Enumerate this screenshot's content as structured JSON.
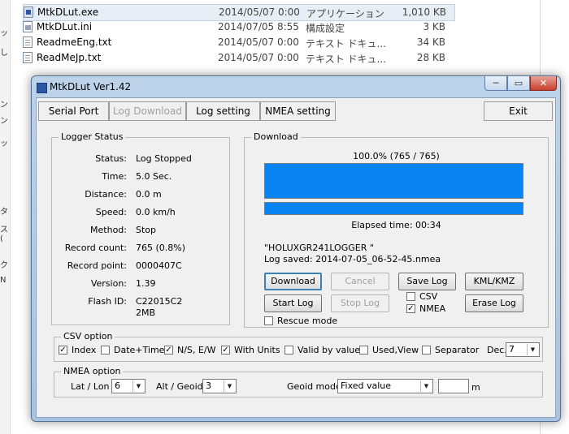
{
  "explorer": {
    "files": [
      {
        "name": "MtkDLut.exe",
        "date": "2014/05/07 0:00",
        "type": "アプリケーション",
        "size": "1,010 KB",
        "icon": "exe-icon"
      },
      {
        "name": "MtkDLut.ini",
        "date": "2014/07/05 8:55",
        "type": "構成設定",
        "size": "3 KB",
        "icon": "ini-icon"
      },
      {
        "name": "ReadmeEng.txt",
        "date": "2014/05/07 0:00",
        "type": "テキスト ドキュ...",
        "size": "34 KB",
        "icon": "text-file-icon"
      },
      {
        "name": "ReadMeJp.txt",
        "date": "2014/05/07 0:00",
        "type": "テキスト ドキュ...",
        "size": "28 KB",
        "icon": "text-file-icon"
      }
    ],
    "left_strip_chars": [
      "ン",
      "ッ",
      "し",
      "ン",
      "ッ",
      "タ",
      "ス (",
      "ク",
      "N"
    ]
  },
  "window": {
    "title": "MtkDLut Ver1.42",
    "minimize": "─",
    "maximize": "▭",
    "close": "✕"
  },
  "menu": {
    "serial_port": "Serial Port",
    "log_download": "Log Download",
    "log_setting": "Log setting",
    "nmea_setting": "NMEA setting",
    "exit": "Exit"
  },
  "logger_status": {
    "title": "Logger Status",
    "rows": [
      {
        "label": "Status:",
        "value": "Log Stopped"
      },
      {
        "label": "Time:",
        "value": "5.0 Sec."
      },
      {
        "label": "Distance:",
        "value": "0.0 m"
      },
      {
        "label": "Speed:",
        "value": "0.0 km/h"
      },
      {
        "label": "Method:",
        "value": "Stop"
      },
      {
        "label": "Record count:",
        "value": "765 (0.8%)"
      },
      {
        "label": "Record point:",
        "value": "0000407C"
      },
      {
        "label": "Version:",
        "value": "1.39"
      },
      {
        "label": "Flash ID:",
        "value": "C22015C2"
      }
    ],
    "flash_id_line2": "2MB"
  },
  "download": {
    "title": "Download",
    "progress_text": "100.0% (765 / 765)",
    "progress_fraction": 1.0,
    "elapsed": "Elapsed time: 00:34",
    "device_name": "\"HOLUXGR241LOGGER    \"",
    "log_saved": "Log saved: 2014-07-05_06-52-45.nmea",
    "buttons": {
      "download": "Download",
      "cancel": "Cancel",
      "save_log": "Save Log",
      "kml_kmz": "KML/KMZ",
      "start_log": "Start Log",
      "stop_log": "Stop Log",
      "erase_log": "Erase Log"
    },
    "csv_label": "CSV",
    "csv_checked": false,
    "nmea_label": "NMEA",
    "nmea_checked": true,
    "rescue_label": "Rescue mode",
    "rescue_checked": false
  },
  "csv_option": {
    "title": "CSV option",
    "options": [
      {
        "label": "Index",
        "checked": true
      },
      {
        "label": "Date+Time",
        "checked": false
      },
      {
        "label": "N/S, E/W",
        "checked": true
      },
      {
        "label": "With Units",
        "checked": true
      },
      {
        "label": "Valid by value",
        "checked": false
      },
      {
        "label": "Used,View",
        "checked": false
      },
      {
        "label": "Separator",
        "checked": false
      }
    ],
    "dec_label": "Dec.",
    "dec_value": "7"
  },
  "nmea_option": {
    "title": "NMEA option",
    "latlon_label": "Lat / Lon",
    "latlon_value": "6",
    "alt_label": "Alt / Geoid",
    "alt_value": "3",
    "geoid_label": "Geoid model",
    "geoid_value": "Fixed value",
    "geoid_input": "",
    "unit": "m"
  }
}
